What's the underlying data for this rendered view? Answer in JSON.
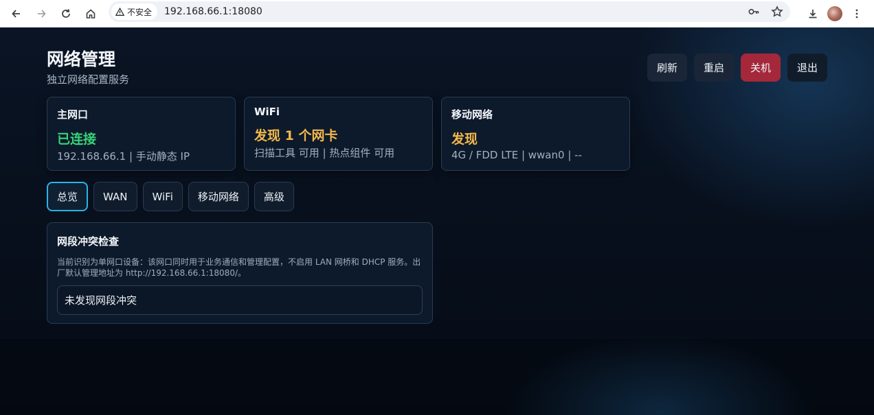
{
  "browser": {
    "security_label": "不安全",
    "url": "192.168.66.1:18080"
  },
  "header": {
    "title": "网络管理",
    "subtitle": "独立网络配置服务"
  },
  "actions": {
    "refresh": "刷新",
    "restart": "重启",
    "shutdown": "关机",
    "logout": "退出"
  },
  "cards": [
    {
      "title": "主网口",
      "status": "已连接",
      "detail": "192.168.66.1 | 手动静态 IP"
    },
    {
      "title": "WiFi",
      "status": "发现 1 个网卡",
      "detail": "扫描工具 可用 | 热点组件 可用"
    },
    {
      "title": "移动网络",
      "status": "发现",
      "detail": "4G / FDD LTE | wwan0 | --"
    }
  ],
  "tabs": [
    "总览",
    "WAN",
    "WiFi",
    "移动网络",
    "高级"
  ],
  "panel": {
    "title": "网段冲突检查",
    "description": "当前识别为单网口设备：该网口同时用于业务通信和管理配置，不启用 LAN 网桥和 DHCP 服务。出厂默认管理地址为 http://192.168.66.1:18080/。",
    "result": "未发现网段冲突"
  },
  "colors": {
    "accent": "#2ab4e6",
    "ok": "#38d37a",
    "warn": "#f2b84b",
    "danger": "#a4283a"
  }
}
